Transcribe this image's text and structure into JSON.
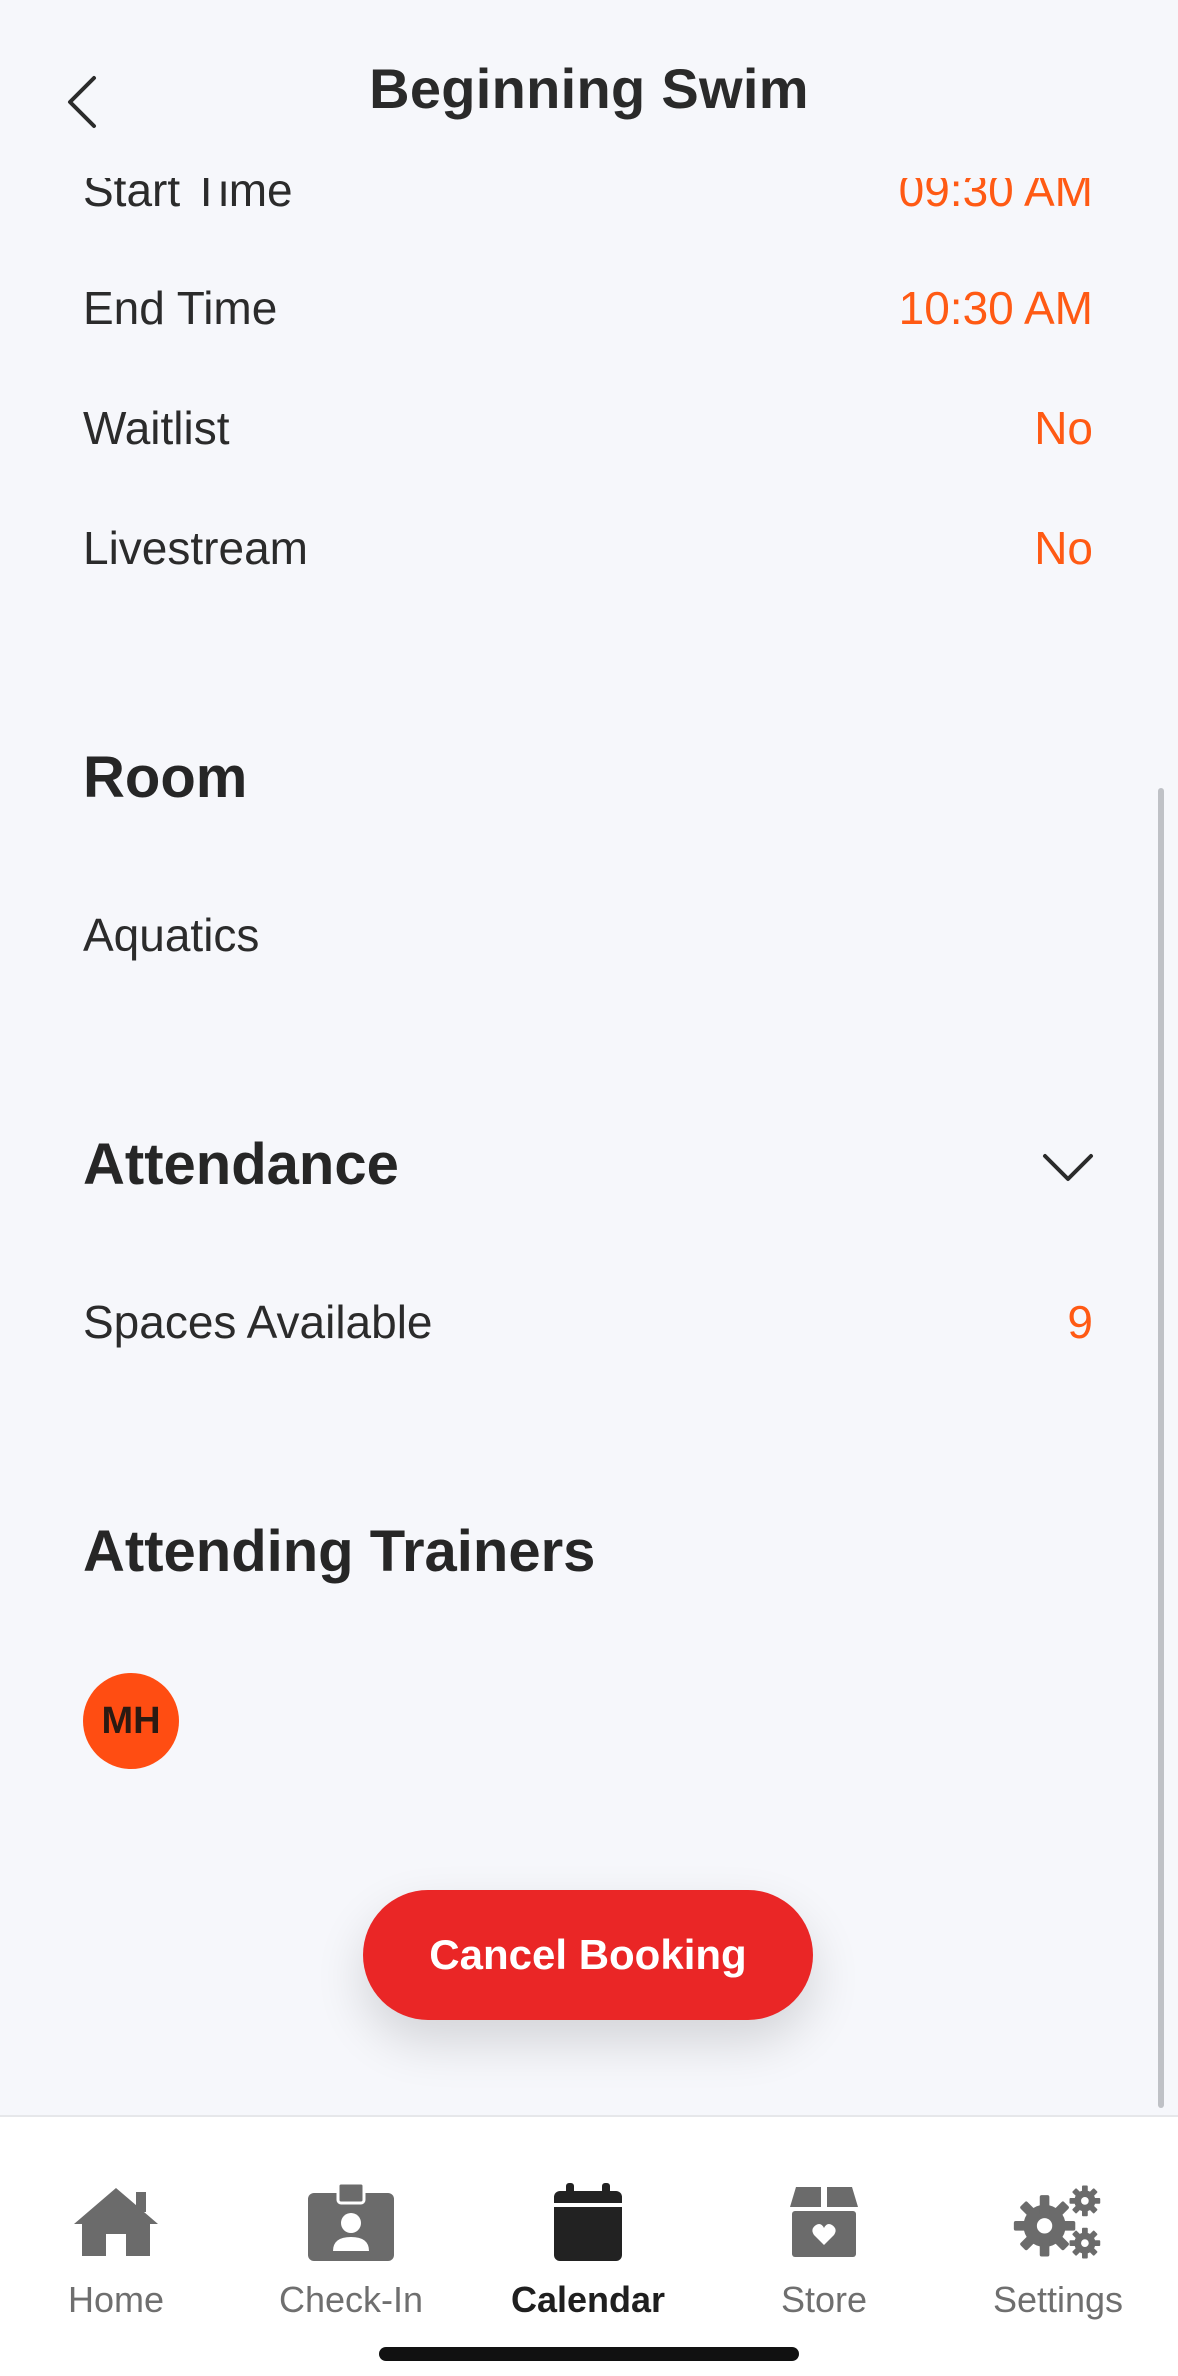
{
  "header": {
    "title": "Beginning Swim"
  },
  "details": [
    {
      "label": "Start Time",
      "value": "09:30 AM"
    },
    {
      "label": "End Time",
      "value": "10:30 AM"
    },
    {
      "label": "Waitlist",
      "value": "No"
    },
    {
      "label": "Livestream",
      "value": "No"
    }
  ],
  "room": {
    "title": "Room",
    "name": "Aquatics"
  },
  "attendance": {
    "title": "Attendance",
    "spaces_label": "Spaces Available",
    "spaces_value": "9"
  },
  "trainers": {
    "title": "Attending Trainers",
    "avatars": [
      {
        "initials": "MH"
      }
    ]
  },
  "actions": {
    "cancel_label": "Cancel Booking"
  },
  "tabbar": {
    "items": [
      {
        "label": "Home",
        "icon": "home-icon",
        "active": false
      },
      {
        "label": "Check-In",
        "icon": "id-badge-icon",
        "active": false
      },
      {
        "label": "Calendar",
        "icon": "calendar-icon",
        "active": true
      },
      {
        "label": "Store",
        "icon": "gift-box-icon",
        "active": false
      },
      {
        "label": "Settings",
        "icon": "gears-icon",
        "active": false
      }
    ]
  },
  "colors": {
    "accent": "#ff5a14",
    "danger": "#ea2626",
    "avatar": "#ff4d12",
    "background": "#f6f7fb"
  }
}
